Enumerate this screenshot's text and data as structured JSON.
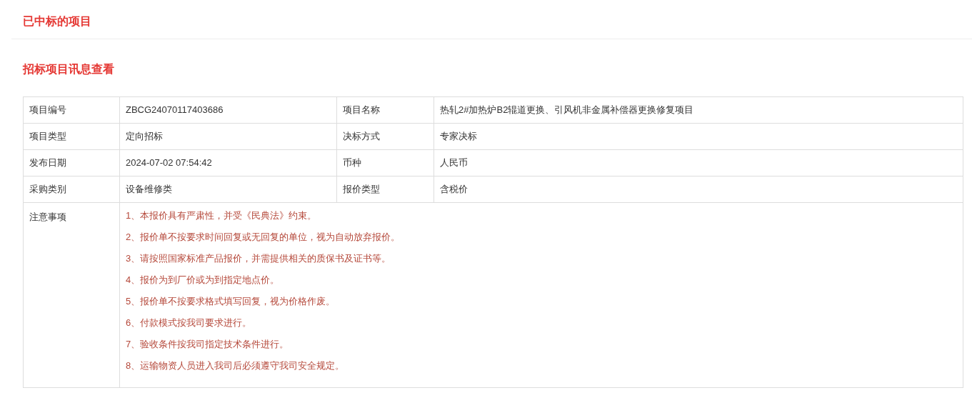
{
  "header": {
    "title": "已中标的项目"
  },
  "section": {
    "title": "招标项目讯息查看"
  },
  "table": {
    "rows": [
      {
        "label_1": "项目编号",
        "value_1": "ZBCG24070117403686",
        "label_2": "项目名称",
        "value_2": "热轧2#加热炉B2辊道更换、引风机非金属补偿器更换修复项目"
      },
      {
        "label_1": "项目类型",
        "value_1": "定向招标",
        "label_2": "决标方式",
        "value_2": "专家决标"
      },
      {
        "label_1": "发布日期",
        "value_1": "2024-07-02 07:54:42",
        "label_2": "币种",
        "value_2": "人民币"
      },
      {
        "label_1": "采购类别",
        "value_1": "设备维修类",
        "label_2": "报价类型",
        "value_2": "含税价"
      }
    ],
    "notes": {
      "label": "注意事项",
      "items": [
        "1、本报价具有严肃性，并受《民典法》约束。",
        "2、报价单不按要求时间回复或无回复的单位，视为自动放弃报价。",
        "3、请按照国家标准产品报价，并需提供相关的质保书及证书等。",
        "4、报价为到厂价或为到指定地点价。",
        "5、报价单不按要求格式填写回复，视为价格作废。",
        "6、付款模式按我司要求进行。",
        "7、验收条件按我司指定技术条件进行。",
        "8、运输物资人员进入我司后必须遵守我司安全规定。"
      ]
    }
  }
}
